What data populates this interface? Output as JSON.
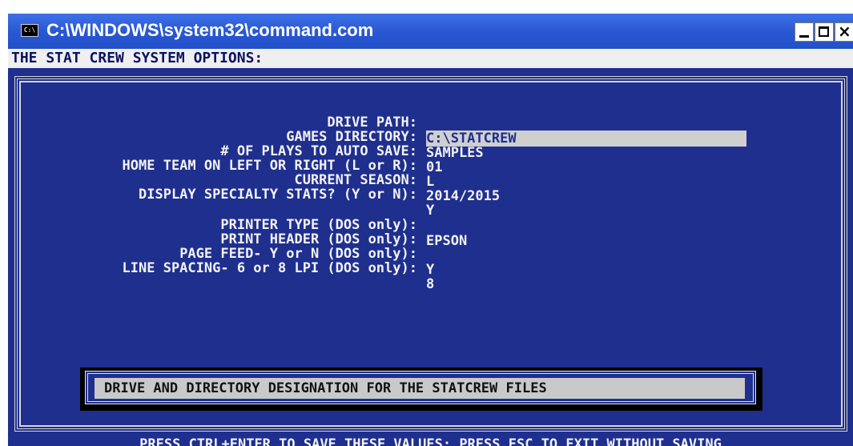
{
  "window": {
    "title": "C:\\WINDOWS\\system32\\command.com",
    "icon_label": "C:\\",
    "buttons": {
      "minimize": "minimize-icon",
      "maximize": "maximize-icon",
      "close": "close-icon"
    }
  },
  "console": {
    "header": "THE STAT CREW SYSTEM OPTIONS:",
    "options": [
      {
        "label": "DRIVE PATH:",
        "value": "C:\\STATCREW"
      },
      {
        "label": "GAMES DIRECTORY:",
        "value": "SAMPLES"
      },
      {
        "label": "# OF PLAYS TO AUTO SAVE:",
        "value": "01"
      },
      {
        "label": "HOME TEAM ON LEFT OR RIGHT (L or R):",
        "value": "L"
      },
      {
        "label": "CURRENT SEASON:",
        "value": "2014/2015"
      },
      {
        "label": "DISPLAY SPECIALTY STATS? (Y or N):",
        "value": "Y"
      },
      {
        "label": "PRINTER TYPE (DOS only):",
        "value": "EPSON"
      },
      {
        "label": "PRINT HEADER (DOS only):",
        "value": ""
      },
      {
        "label": "PAGE FEED- Y or N (DOS only):",
        "value": "Y"
      },
      {
        "label": "LINE SPACING- 6 or 8 LPI (DOS only):",
        "value": "8"
      }
    ],
    "help_message": "DRIVE AND DIRECTORY DESIGNATION FOR THE STATCREW FILES",
    "footer": "PRESS CTRL+ENTER TO SAVE THESE VALUES; PRESS ESC TO EXIT WITHOUT SAVING"
  },
  "colors": {
    "console_background": "#1f2f8e",
    "titlebar_blue": "#2a58d4",
    "text": "#f2f2f2",
    "highlight": "#cfcfcf"
  }
}
